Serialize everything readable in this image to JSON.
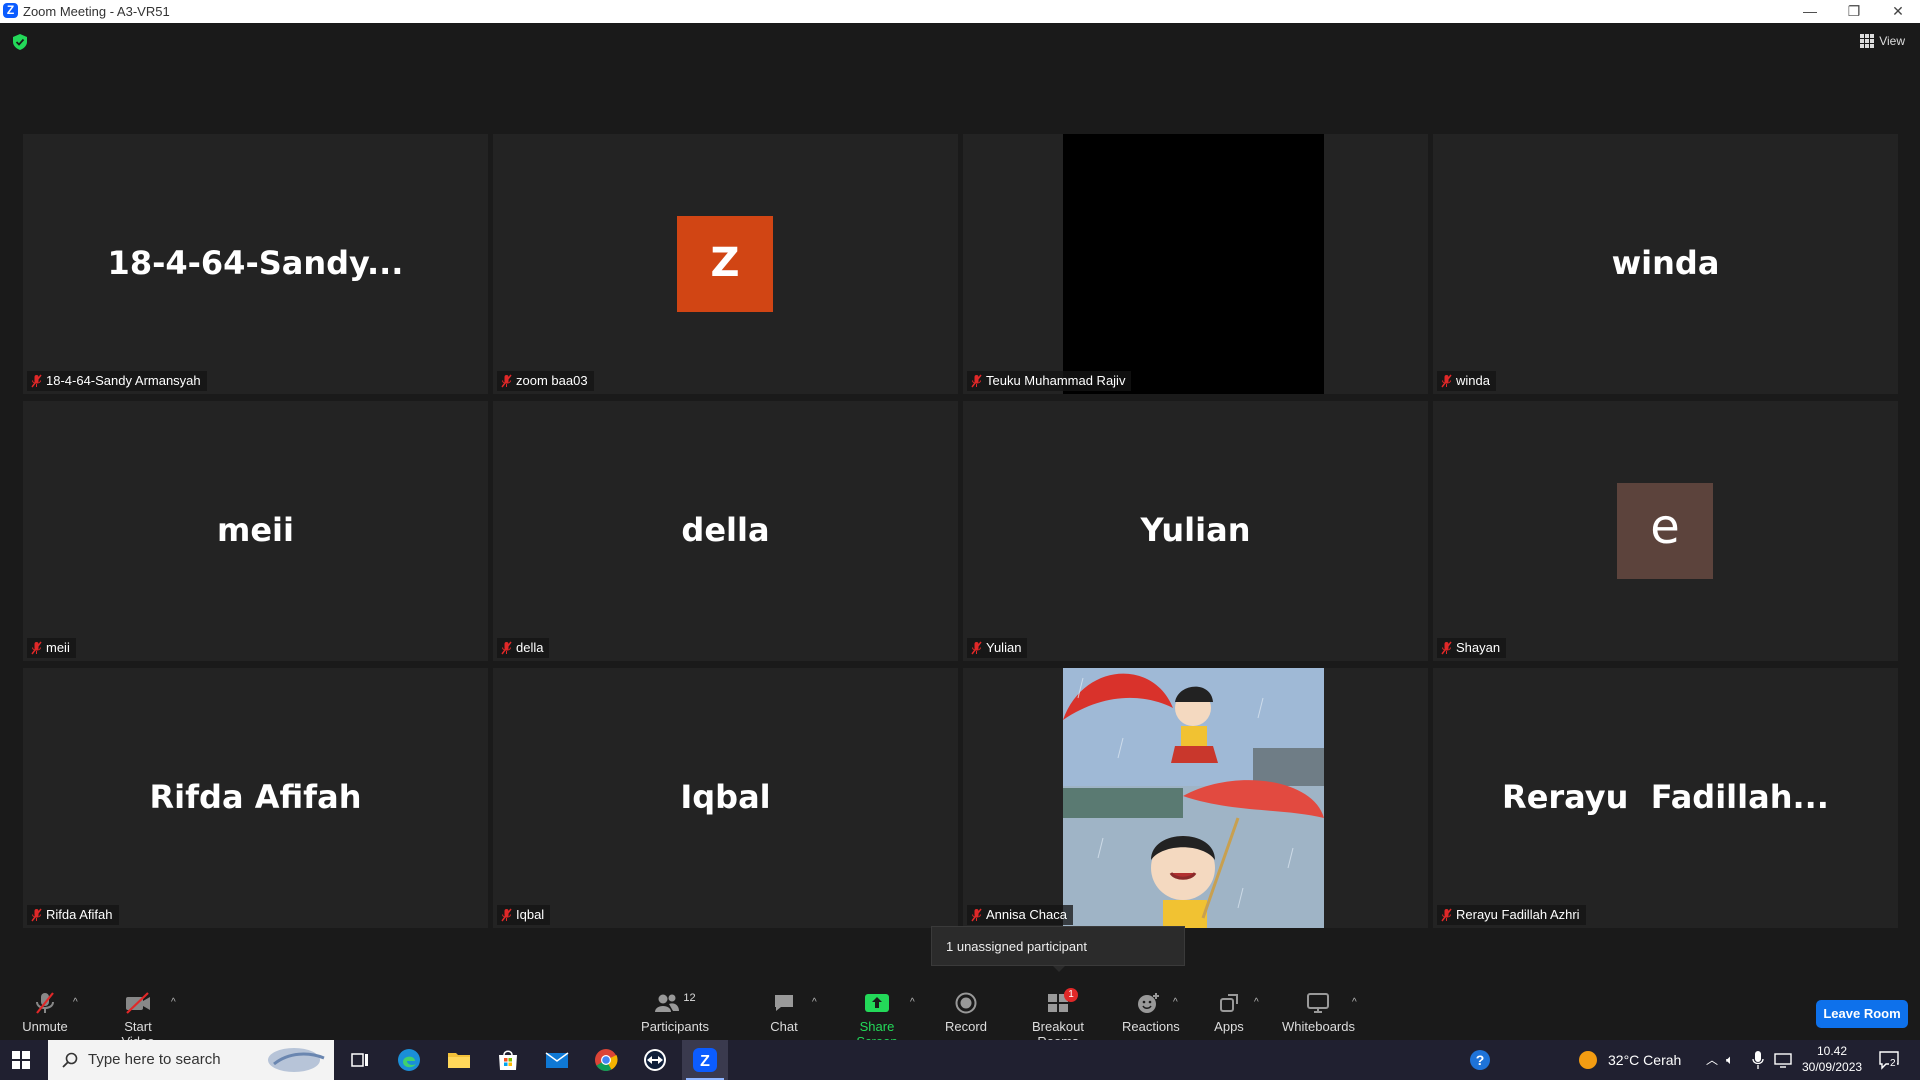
{
  "window": {
    "title": "Zoom Meeting - A3-VR51",
    "min": "—",
    "restore": "❐",
    "close": "✕"
  },
  "view_label": "View",
  "tiles": [
    {
      "display": "18-4-64-Sandy...",
      "label": "18-4-64-Sandy Armansyah"
    },
    {
      "avatar_letter": "Z",
      "avatar_color": "#d14514",
      "label": "zoom baa03"
    },
    {
      "label": "Teuku Muhammad Rajiv"
    },
    {
      "display": "winda",
      "label": "winda"
    },
    {
      "display": "meii",
      "label": "meii"
    },
    {
      "display": "della",
      "label": "della"
    },
    {
      "display": "Yulian",
      "label": "Yulian"
    },
    {
      "avatar_letter": "e",
      "avatar_color": "#5c433c",
      "label": "Shayan"
    },
    {
      "display": "Rifda Afifah",
      "label": "Rifda Afifah"
    },
    {
      "display": "Iqbal",
      "label": "Iqbal"
    },
    {
      "label": "Annisa Chaca"
    },
    {
      "display": "Rerayu  Fadillah...",
      "label": "Rerayu Fadillah Azhri"
    }
  ],
  "tooltip": "1 unassigned participant",
  "toolbar": {
    "unmute": "Unmute",
    "start_video": "Start Video",
    "participants": "Participants",
    "participants_count": "12",
    "chat": "Chat",
    "share_screen": "Share Screen",
    "record": "Record",
    "breakout_rooms": "Breakout Rooms",
    "breakout_badge": "1",
    "reactions": "Reactions",
    "apps": "Apps",
    "whiteboards": "Whiteboards",
    "leave": "Leave Room"
  },
  "colors": {
    "muted": "#e02828",
    "share_green": "#23d959",
    "leave_blue": "#0e71eb"
  },
  "taskbar": {
    "search_placeholder": "Type here to search",
    "weather": "32°C  Cerah",
    "time": "10.42",
    "date": "30/09/2023",
    "notif_count": "2"
  }
}
